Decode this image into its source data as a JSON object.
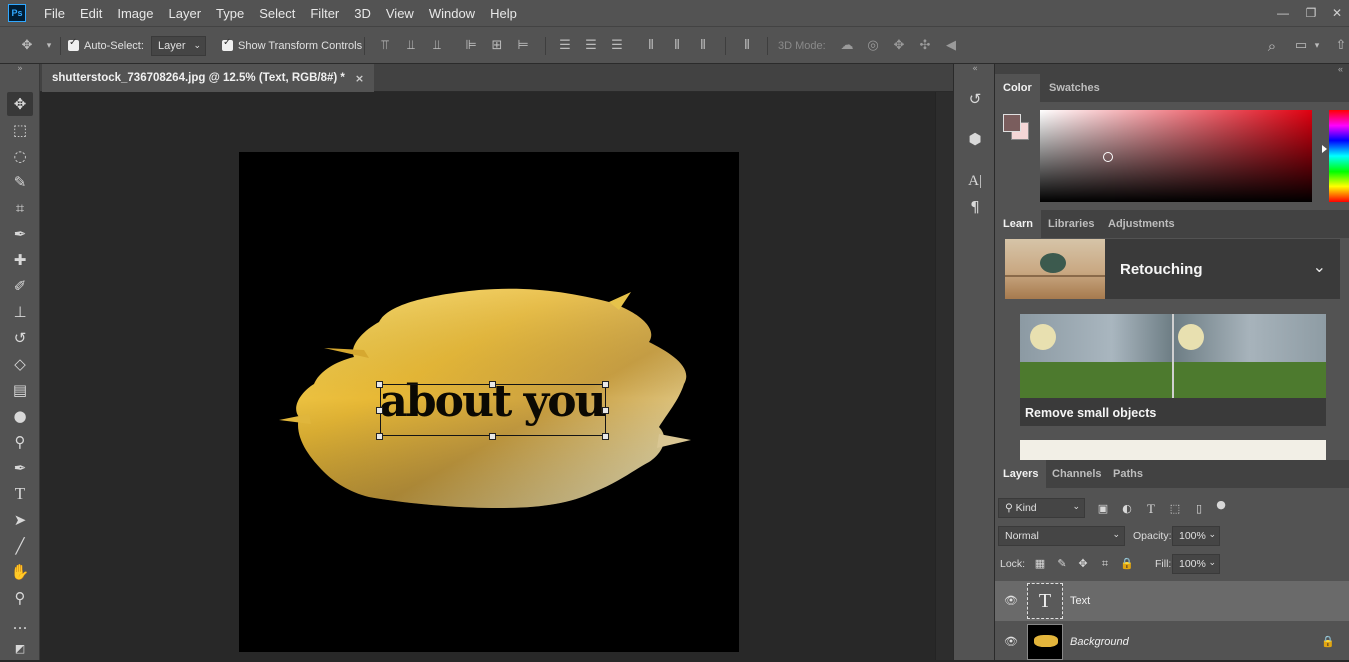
{
  "menu": [
    "File",
    "Edit",
    "Image",
    "Layer",
    "Type",
    "Select",
    "Filter",
    "3D",
    "View",
    "Window",
    "Help"
  ],
  "app_logo": "Ps",
  "window_controls": {
    "minimize": "—",
    "restore": "❐",
    "close": "✕"
  },
  "options_bar": {
    "auto_select_label": "Auto-Select:",
    "auto_select_value": "Layer",
    "show_transform_label": "Show Transform Controls",
    "mode_3d_label": "3D Mode:"
  },
  "document": {
    "tab_title": "shutterstock_736708264.jpg @ 12.5% (Text, RGB/8#) *",
    "tab_close": "×",
    "canvas_text": "about you"
  },
  "color_panel": {
    "tabs": [
      "Color",
      "Swatches"
    ],
    "foreground": "#7a5d5d",
    "background": "#f4d6d6"
  },
  "learn_panel": {
    "tabs": [
      "Learn",
      "Libraries",
      "Adjustments"
    ],
    "section_title": "Retouching",
    "tutorial_title": "Remove small objects"
  },
  "layers_panel": {
    "tabs": [
      "Layers",
      "Channels",
      "Paths"
    ],
    "filter_kind": "Kind",
    "blend_mode": "Normal",
    "opacity_label": "Opacity:",
    "opacity_value": "100%",
    "lock_label": "Lock:",
    "fill_label": "Fill:",
    "fill_value": "100%",
    "layers": [
      {
        "name": "Text",
        "type": "text",
        "selected": true
      },
      {
        "name": "Background",
        "type": "image",
        "selected": false,
        "locked": true
      }
    ]
  }
}
